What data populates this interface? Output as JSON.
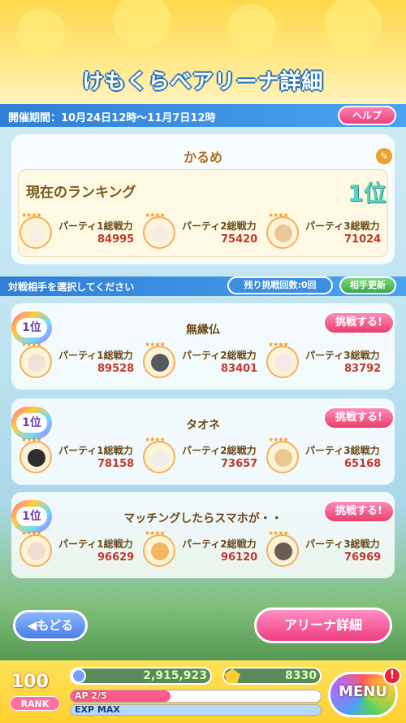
{
  "title": "けもくらべアリーナ詳細",
  "period": "開催期間：10月24日12時～11月7日12時",
  "help_label": "ヘルプ",
  "me": {
    "name": "かるめ",
    "ranking_label": "現在のランキング",
    "rank": "1位",
    "parties": [
      {
        "label": "パーティ1総戦力",
        "value": "84995",
        "color": "#f5f0e6"
      },
      {
        "label": "パーティ2総戦力",
        "value": "75420",
        "color": "#f2eee4"
      },
      {
        "label": "パーティ3総戦力",
        "value": "71024",
        "color": "#e9c79a"
      }
    ]
  },
  "select_label": "対戦相手を選択してください",
  "remaining_label": "残り挑戦回数:0回",
  "refresh_label": "相手更新",
  "challenge_label": "挑戦する!",
  "opponents": [
    {
      "rank": "1位",
      "name": "無縁仏",
      "parties": [
        {
          "label": "パーティ1総戦力",
          "value": "89528",
          "color": "#f1e2d8"
        },
        {
          "label": "パーティ2総戦力",
          "value": "83401",
          "color": "#555a62"
        },
        {
          "label": "パーティ3総戦力",
          "value": "83792",
          "color": "#f4e8ea"
        }
      ]
    },
    {
      "rank": "1位",
      "name": "タオネ",
      "parties": [
        {
          "label": "パーティ1総戦力",
          "value": "78158",
          "color": "#2e2e30"
        },
        {
          "label": "パーティ2総戦力",
          "value": "73657",
          "color": "#f0ece8"
        },
        {
          "label": "パーティ3総戦力",
          "value": "65168",
          "color": "#e8c890"
        }
      ]
    },
    {
      "rank": "1位",
      "name": "マッチングしたらスマホが・・",
      "parties": [
        {
          "label": "パーティ1総戦力",
          "value": "96629",
          "color": "#f0ddd2"
        },
        {
          "label": "パーティ2総戦力",
          "value": "96120",
          "color": "#f2b660"
        },
        {
          "label": "パーティ3総戦力",
          "value": "76969",
          "color": "#6a5e54"
        }
      ]
    }
  ],
  "back_label": "もどる",
  "arena_label": "アリーナ詳細",
  "status": {
    "rank_num": "100",
    "rank_tag": "RANK",
    "coins": "2,915,923",
    "gems": "8330",
    "ap": "AP 2/5",
    "ap_fraction": 0.4,
    "exp": "EXP MAX"
  },
  "menu_label": "MENU",
  "menu_alert": "!"
}
